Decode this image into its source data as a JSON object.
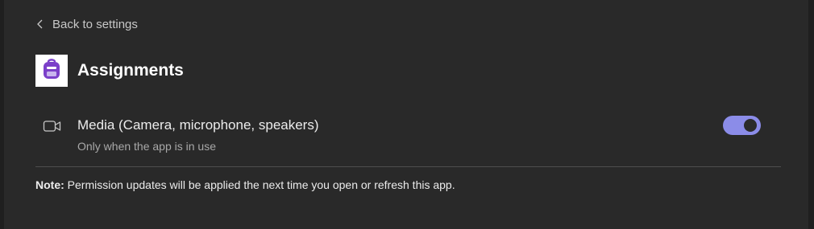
{
  "nav": {
    "back_label": "Back to settings",
    "back_icon": "chevron-left-icon"
  },
  "app": {
    "name": "Assignments",
    "logo_icon": "backpack-icon",
    "logo_color": "#7B3FC9"
  },
  "permissions": [
    {
      "icon": "video-camera-icon",
      "title": "Media (Camera, microphone, speakers)",
      "subtitle": "Only when the app is in use",
      "enabled": true
    }
  ],
  "note": {
    "label": "Note:",
    "text": " Permission updates will be applied the next time you open or refresh this app."
  },
  "colors": {
    "background": "#292929",
    "toggle_on": "#8B8CE8",
    "text_primary": "#ECECEC",
    "text_secondary": "#A8A8A8"
  }
}
